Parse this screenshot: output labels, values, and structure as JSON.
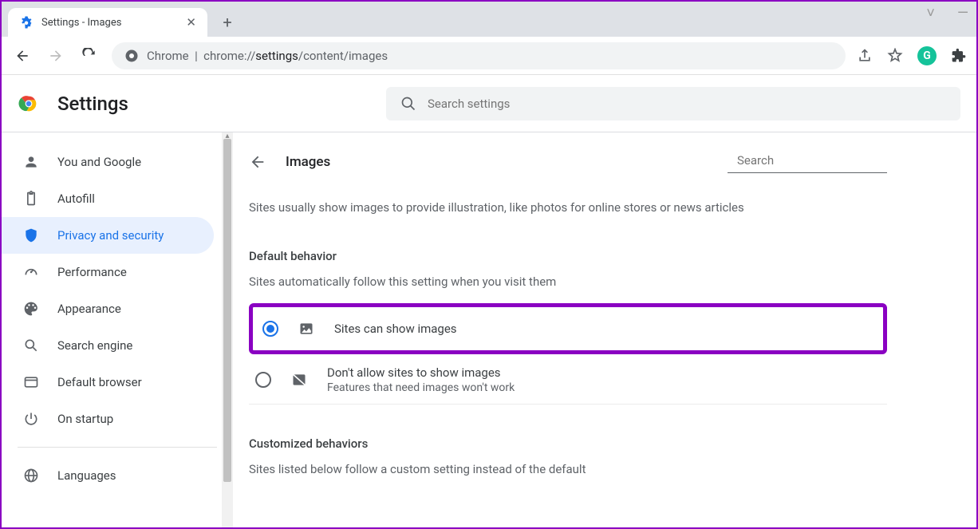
{
  "window": {
    "tab_title": "Settings - Images"
  },
  "address": {
    "prefix": "Chrome",
    "url_before": "chrome://",
    "url_bold": "settings",
    "url_after": "/content/images"
  },
  "header": {
    "title": "Settings",
    "search_placeholder": "Search settings"
  },
  "sidebar": {
    "items": [
      {
        "label": "You and Google"
      },
      {
        "label": "Autofill"
      },
      {
        "label": "Privacy and security"
      },
      {
        "label": "Performance"
      },
      {
        "label": "Appearance"
      },
      {
        "label": "Search engine"
      },
      {
        "label": "Default browser"
      },
      {
        "label": "On startup"
      }
    ],
    "extra": {
      "label": "Languages"
    }
  },
  "page": {
    "title": "Images",
    "search_placeholder": "Search",
    "description": "Sites usually show images to provide illustration, like photos for online stores or news articles",
    "default_behavior_title": "Default behavior",
    "default_behavior_sub": "Sites automatically follow this setting when you visit them",
    "option_allow": "Sites can show images",
    "option_block": "Don't allow sites to show images",
    "option_block_sub": "Features that need images won't work",
    "custom_title": "Customized behaviors",
    "custom_sub": "Sites listed below follow a custom setting instead of the default"
  }
}
